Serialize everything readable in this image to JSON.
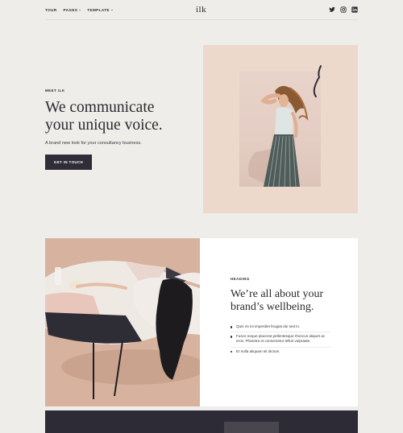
{
  "nav": {
    "links": [
      {
        "label": "TOUR",
        "dropdown": false
      },
      {
        "label": "PAGES",
        "dropdown": true
      },
      {
        "label": "TEMPLATE",
        "dropdown": true
      }
    ],
    "logo": "ilk",
    "social": [
      "twitter-icon",
      "instagram-icon",
      "linkedin-icon"
    ]
  },
  "hero": {
    "eyebrow": "MEET ILK",
    "title_line1": "We communicate",
    "title_line2": "your unique voice.",
    "subtitle": "A brand new look for your consultancy business.",
    "cta_label": "GET IN TOUCH"
  },
  "section2": {
    "eyebrow": "HEADING",
    "title_line1": "We’re all about your",
    "title_line2": "brand’s wellbeing.",
    "bullets": [
      "Quis mi mi imperdiet feugiat dui sed in.",
      "Fusce neque placerat pellentesque rhoncus aliquet ac eros. Pharetra et consectetur tellus vulputate.",
      "Et nulla aliquam sit dictum."
    ]
  },
  "colors": {
    "background": "#efede9",
    "dark": "#2c2b36",
    "hero_panel": "#ecd9cc",
    "accent_photo": "#d7b39f"
  }
}
